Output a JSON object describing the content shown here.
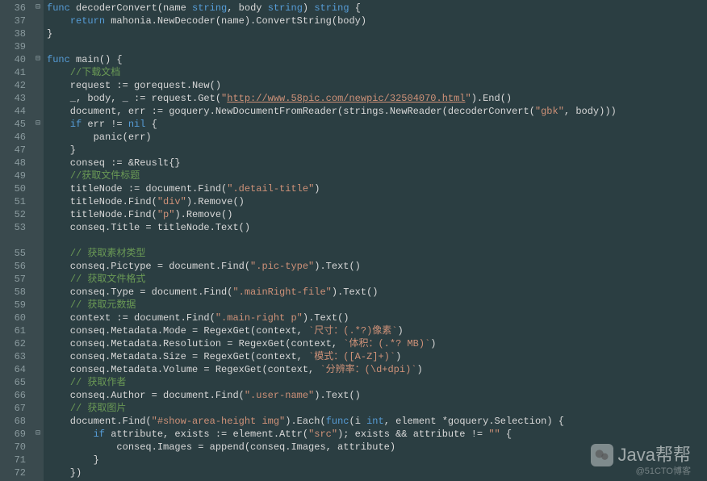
{
  "line_numbers": [
    "36",
    "37",
    "38",
    "39",
    "40",
    "41",
    "42",
    "43",
    "44",
    "45",
    "46",
    "47",
    "48",
    "49",
    "50",
    "51",
    "52",
    "53",
    "",
    "55",
    "56",
    "57",
    "58",
    "59",
    "60",
    "61",
    "62",
    "63",
    "64",
    "65",
    "66",
    "67",
    "68",
    "69",
    "70",
    "71",
    "72"
  ],
  "fold_markers": {
    "0": "⊟",
    "4": "⊟",
    "9": "⊟",
    "32": "",
    "33": "⊟",
    "34": ""
  },
  "code_lines": [
    {
      "t": [
        [
          "kw",
          "func"
        ],
        [
          "op",
          " decoderConvert(name "
        ],
        [
          "kw",
          "string"
        ],
        [
          "op",
          ", body "
        ],
        [
          "kw",
          "string"
        ],
        [
          "op",
          ") "
        ],
        [
          "kw",
          "string"
        ],
        [
          "op",
          " {"
        ]
      ]
    },
    {
      "t": [
        [
          "op",
          "    "
        ],
        [
          "kw",
          "return"
        ],
        [
          "op",
          " mahonia.NewDecoder(name).ConvertString(body)"
        ]
      ]
    },
    {
      "t": [
        [
          "op",
          "}"
        ]
      ]
    },
    {
      "t": [
        [
          "op",
          ""
        ]
      ]
    },
    {
      "t": [
        [
          "kw",
          "func"
        ],
        [
          "op",
          " main() {"
        ]
      ]
    },
    {
      "t": [
        [
          "op",
          "    "
        ],
        [
          "cmt",
          "//下载文档"
        ]
      ]
    },
    {
      "t": [
        [
          "op",
          "    request := gorequest.New()"
        ]
      ]
    },
    {
      "t": [
        [
          "op",
          "    _, body, _ := request.Get("
        ],
        [
          "str",
          "\""
        ],
        [
          "link",
          "http://www.58pic.com/newpic/32504070.html"
        ],
        [
          "str",
          "\""
        ],
        [
          "op",
          ").End()"
        ]
      ]
    },
    {
      "t": [
        [
          "op",
          "    document, err := goquery.NewDocumentFromReader(strings.NewReader(decoderConvert("
        ],
        [
          "str",
          "\"gbk\""
        ],
        [
          "op",
          ", body)))"
        ]
      ]
    },
    {
      "t": [
        [
          "op",
          "    "
        ],
        [
          "kw",
          "if"
        ],
        [
          "op",
          " err != "
        ],
        [
          "kw",
          "nil"
        ],
        [
          "op",
          " {"
        ]
      ]
    },
    {
      "t": [
        [
          "op",
          "        panic(err)"
        ]
      ]
    },
    {
      "t": [
        [
          "op",
          "    }"
        ]
      ]
    },
    {
      "t": [
        [
          "op",
          "    conseq := &Reuslt{}"
        ]
      ]
    },
    {
      "t": [
        [
          "op",
          "    "
        ],
        [
          "cmt",
          "//获取文件标题"
        ]
      ]
    },
    {
      "t": [
        [
          "op",
          "    titleNode := document.Find("
        ],
        [
          "str",
          "\".detail-title\""
        ],
        [
          "op",
          ")"
        ]
      ]
    },
    {
      "t": [
        [
          "op",
          "    titleNode.Find("
        ],
        [
          "str",
          "\"div\""
        ],
        [
          "op",
          ").Remove()"
        ]
      ]
    },
    {
      "t": [
        [
          "op",
          "    titleNode.Find("
        ],
        [
          "str",
          "\"p\""
        ],
        [
          "op",
          ").Remove()"
        ]
      ]
    },
    {
      "t": [
        [
          "op",
          "    conseq.Title = titleNode.Text()"
        ]
      ]
    },
    {
      "t": [
        [
          "op",
          ""
        ]
      ]
    },
    {
      "t": [
        [
          "op",
          "    "
        ],
        [
          "cmt",
          "// 获取素材类型"
        ]
      ]
    },
    {
      "t": [
        [
          "op",
          "    conseq.Pictype = document.Find("
        ],
        [
          "str",
          "\".pic-type\""
        ],
        [
          "op",
          ").Text()"
        ]
      ]
    },
    {
      "t": [
        [
          "op",
          "    "
        ],
        [
          "cmt",
          "// 获取文件格式"
        ]
      ]
    },
    {
      "t": [
        [
          "op",
          "    conseq.Type = document.Find("
        ],
        [
          "str",
          "\".mainRight-file\""
        ],
        [
          "op",
          ").Text()"
        ]
      ]
    },
    {
      "t": [
        [
          "op",
          "    "
        ],
        [
          "cmt",
          "// 获取元数据"
        ]
      ]
    },
    {
      "t": [
        [
          "op",
          "    context := document.Find("
        ],
        [
          "str",
          "\".main-right p\""
        ],
        [
          "op",
          ").Text()"
        ]
      ]
    },
    {
      "t": [
        [
          "op",
          "    conseq.Metadata.Mode = RegexGet(context, "
        ],
        [
          "str",
          "`尺寸：(.*?)像素`"
        ],
        [
          "op",
          ")"
        ]
      ]
    },
    {
      "t": [
        [
          "op",
          "    conseq.Metadata.Resolution = RegexGet(context, "
        ],
        [
          "str",
          "`体积：(.*? MB)`"
        ],
        [
          "op",
          ")"
        ]
      ]
    },
    {
      "t": [
        [
          "op",
          "    conseq.Metadata.Size = RegexGet(context, "
        ],
        [
          "str",
          "`模式：([A-Z]+)`"
        ],
        [
          "op",
          ")"
        ]
      ]
    },
    {
      "t": [
        [
          "op",
          "    conseq.Metadata.Volume = RegexGet(context, "
        ],
        [
          "str",
          "`分辨率：(\\d+dpi)`"
        ],
        [
          "op",
          ")"
        ]
      ]
    },
    {
      "t": [
        [
          "op",
          "    "
        ],
        [
          "cmt",
          "// 获取作者"
        ]
      ]
    },
    {
      "t": [
        [
          "op",
          "    conseq.Author = document.Find("
        ],
        [
          "str",
          "\".user-name\""
        ],
        [
          "op",
          ").Text()"
        ]
      ]
    },
    {
      "t": [
        [
          "op",
          "    "
        ],
        [
          "cmt",
          "// 获取图片"
        ]
      ]
    },
    {
      "t": [
        [
          "op",
          "    document.Find("
        ],
        [
          "str",
          "\"#show-area-height img\""
        ],
        [
          "op",
          ").Each("
        ],
        [
          "kw",
          "func"
        ],
        [
          "op",
          "(i "
        ],
        [
          "kw",
          "int"
        ],
        [
          "op",
          ", element *goquery.Selection) {"
        ]
      ]
    },
    {
      "t": [
        [
          "op",
          "        "
        ],
        [
          "kw",
          "if"
        ],
        [
          "op",
          " attribute, exists := element.Attr("
        ],
        [
          "str",
          "\"src\""
        ],
        [
          "op",
          "); exists && attribute != "
        ],
        [
          "str",
          "\"\""
        ],
        [
          "op",
          " {"
        ]
      ]
    },
    {
      "t": [
        [
          "op",
          "            conseq.Images = append(conseq.Images, attribute)"
        ]
      ]
    },
    {
      "t": [
        [
          "op",
          "        }"
        ]
      ]
    },
    {
      "t": [
        [
          "op",
          "    })"
        ]
      ]
    }
  ],
  "watermark": {
    "main": "Java帮帮",
    "sub": "@51CTO博客"
  }
}
